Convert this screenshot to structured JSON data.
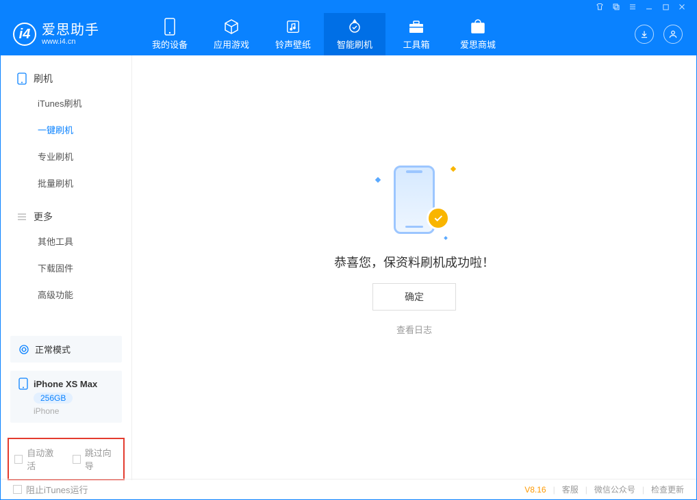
{
  "titlebar": {
    "icons": [
      "shirt-icon",
      "layers-icon",
      "list-icon",
      "minimize-icon",
      "maximize-icon",
      "close-icon"
    ]
  },
  "logo": {
    "name": "爱思助手",
    "url": "www.i4.cn"
  },
  "tabs": [
    {
      "label": "我的设备",
      "icon": "device-icon"
    },
    {
      "label": "应用游戏",
      "icon": "cube-icon"
    },
    {
      "label": "铃声壁纸",
      "icon": "music-icon"
    },
    {
      "label": "智能刷机",
      "icon": "refresh-icon",
      "active": true
    },
    {
      "label": "工具箱",
      "icon": "toolbox-icon"
    },
    {
      "label": "爱思商城",
      "icon": "store-icon"
    }
  ],
  "sidebar": {
    "sections": [
      {
        "title": "刷机",
        "icon": "phone-icon",
        "items": [
          "iTunes刷机",
          "一键刷机",
          "专业刷机",
          "批量刷机"
        ],
        "active_index": 1
      },
      {
        "title": "更多",
        "icon": "hamburger-icon",
        "items": [
          "其他工具",
          "下载固件",
          "高级功能"
        ]
      }
    ],
    "status": {
      "label": "正常模式",
      "icon": "sync-icon"
    },
    "device": {
      "name": "iPhone XS Max",
      "storage": "256GB",
      "model": "iPhone"
    },
    "checkboxes": {
      "auto_activate": "自动激活",
      "skip_guide": "跳过向导"
    }
  },
  "main": {
    "success_text": "恭喜您，保资料刷机成功啦！",
    "ok_button": "确定",
    "view_log": "查看日志"
  },
  "footer": {
    "block_itunes": "阻止iTunes运行",
    "version": "V8.16",
    "links": [
      "客服",
      "微信公众号",
      "检查更新"
    ]
  },
  "colors": {
    "primary": "#0a82ff",
    "accent": "#f9b500",
    "highlight_border": "#e33b2e"
  }
}
